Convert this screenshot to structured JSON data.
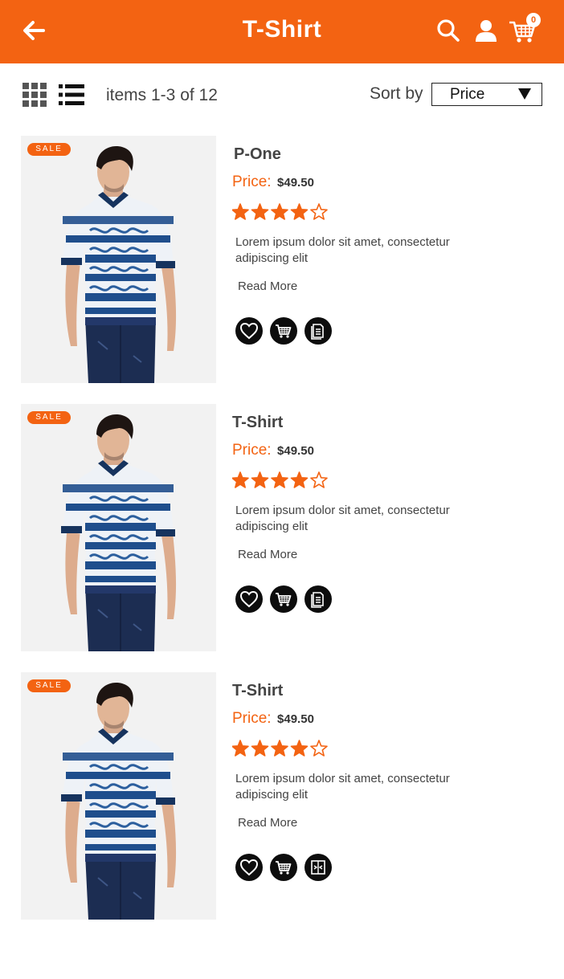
{
  "header": {
    "title": "T-Shirt",
    "cart_count": "0",
    "accent_color": "#f36312"
  },
  "toolbar": {
    "items_count": "items 1-3 of 12",
    "sort_label": "Sort by",
    "sort_value": "Price"
  },
  "products": [
    {
      "sale": "SALE",
      "name": "P-One",
      "price_label": "Price:",
      "price": "$49.50",
      "rating": 4,
      "rating_max": 5,
      "description": "Lorem ipsum dolor sit amet, consectetur adipiscing elit",
      "read_more": "Read More",
      "actions": [
        "heart-icon",
        "cart-icon",
        "document-icon"
      ]
    },
    {
      "sale": "SALE",
      "name": "T-Shirt",
      "price_label": "Price:",
      "price": "$49.50",
      "rating": 4,
      "rating_max": 5,
      "description": "Lorem ipsum dolor sit amet, consectetur adipiscing elit",
      "read_more": "Read More",
      "actions": [
        "heart-icon",
        "cart-icon",
        "document-icon"
      ]
    },
    {
      "sale": "SALE",
      "name": "T-Shirt",
      "price_label": "Price:",
      "price": "$49.50",
      "rating": 4,
      "rating_max": 5,
      "description": "Lorem ipsum dolor sit amet, consectetur adipiscing elit",
      "read_more": "Read More",
      "actions": [
        "heart-icon",
        "cart-icon",
        "compare-icon"
      ]
    }
  ]
}
